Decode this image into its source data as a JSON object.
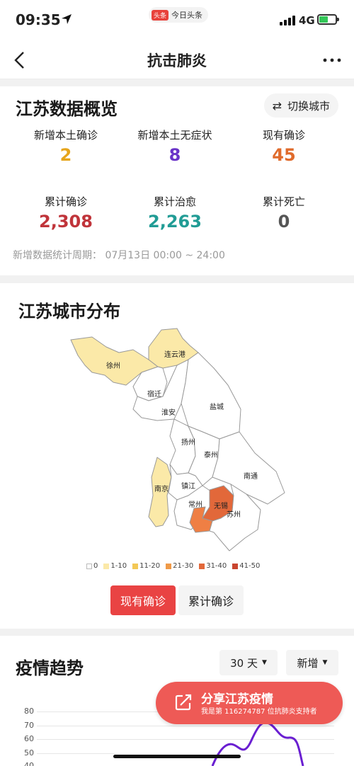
{
  "status_bar": {
    "time": "09:35",
    "app_logo": "头条",
    "app_name": "今日头条",
    "network": "4G"
  },
  "nav": {
    "title": "抗击肺炎"
  },
  "overview": {
    "title": "江苏数据概览",
    "switch_label": "切换城市",
    "stats": [
      {
        "label": "新增本土确诊",
        "value": "2",
        "color": "#e6a51c"
      },
      {
        "label": "新增本土无症状",
        "value": "8",
        "color": "#6a33c8"
      },
      {
        "label": "现有确诊",
        "value": "45",
        "color": "#e06b2c"
      },
      {
        "label": "累计确诊",
        "value": "2,308",
        "color": "#c0343a"
      },
      {
        "label": "累计治愈",
        "value": "2,263",
        "color": "#219c95"
      },
      {
        "label": "累计死亡",
        "value": "0",
        "color": "#555555"
      }
    ],
    "period_label": "新增数据统计周期：",
    "period_value": "07月13日 00:00 ~ 24:00"
  },
  "city_map": {
    "title": "江苏城市分布",
    "cities": [
      "徐州",
      "连云港",
      "宿迁",
      "淮安",
      "盐城",
      "扬州",
      "泰州",
      "南通",
      "南京",
      "镇江",
      "常州",
      "无锡",
      "苏州"
    ],
    "legend": [
      {
        "label": "0",
        "color": "#ffffff"
      },
      {
        "label": "1-10",
        "color": "#fbe9a8"
      },
      {
        "label": "11-20",
        "color": "#f3c856"
      },
      {
        "label": "21-30",
        "color": "#ef9a48"
      },
      {
        "label": "31-40",
        "color": "#e2683a"
      },
      {
        "label": "41-50",
        "color": "#c9452f"
      }
    ],
    "tabs": [
      "现有确诊",
      "累计确诊"
    ],
    "active_tab": "现有确诊"
  },
  "trend": {
    "title": "疫情趋势",
    "range_select": "30 天",
    "type_select": "新增",
    "y_ticks": [
      "80",
      "70",
      "60",
      "50",
      "40"
    ]
  },
  "share": {
    "title": "分享江苏疫情",
    "subtitle": "我是第 116274787 位抗肺炎支持者"
  }
}
